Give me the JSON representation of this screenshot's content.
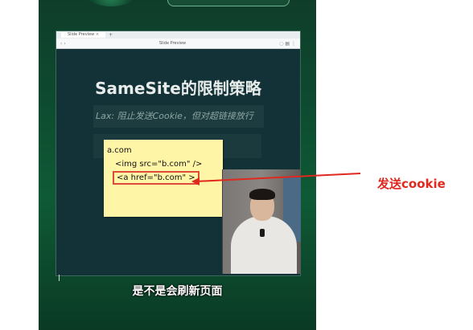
{
  "browser": {
    "tab_label": "Slide Preview",
    "tab_close": "×",
    "tab_plus": "+",
    "url": "Slide Preview",
    "nav": "‹ ›",
    "icons": "◌ ▤ ⋮"
  },
  "slide": {
    "title": "SameSite的限制策略",
    "lax_text": "Lax: 阻止发送Cookie，但对超链接放行"
  },
  "note": {
    "line1": "a.com",
    "line2": "<img src=\"b.com\" />",
    "line3": "<a href=\"b.com\" >"
  },
  "annotation": {
    "text": "发送cookie",
    "color": "#e0281e"
  },
  "subtitle": "是不是会刷新页面"
}
